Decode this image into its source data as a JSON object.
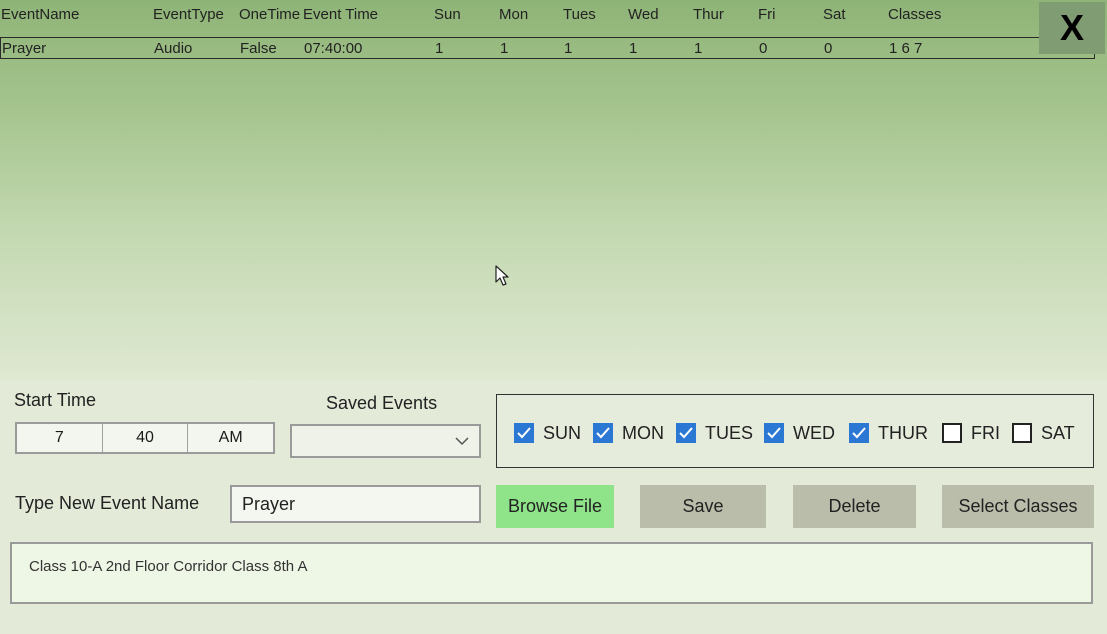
{
  "table": {
    "columns": [
      "EventName",
      "EventType",
      "OneTime",
      "Event Time",
      "Sun",
      "Mon",
      "Tues",
      "Wed",
      "Thur",
      "Fri",
      "Sat",
      "Classes"
    ],
    "rows": [
      [
        "Prayer",
        "Audio",
        "False",
        "07:40:00",
        "1",
        "1",
        "1",
        "1",
        "1",
        "0",
        "0",
        "1 6 7"
      ]
    ]
  },
  "close_button": {
    "label": "X"
  },
  "start_time": {
    "label": "Start Time",
    "hour": "7",
    "minute": "40",
    "period": "AM"
  },
  "saved_events": {
    "label": "Saved Events",
    "value": ""
  },
  "days": [
    {
      "label": "SUN",
      "checked": true
    },
    {
      "label": "MON",
      "checked": true
    },
    {
      "label": "TUES",
      "checked": true
    },
    {
      "label": "WED",
      "checked": true
    },
    {
      "label": "THUR",
      "checked": true
    },
    {
      "label": "FRI",
      "checked": false
    },
    {
      "label": "SAT",
      "checked": false
    }
  ],
  "event_name": {
    "label": "Type New Event Name",
    "value": "Prayer"
  },
  "buttons": {
    "browse": "Browse File",
    "save": "Save",
    "delete": "Delete",
    "select_classes": "Select Classes"
  },
  "classes_text": "Class 10-A 2nd Floor Corridor Class 8th A",
  "colors": {
    "checkbox_on": "#2a78d4",
    "browse_button": "#8fe48a",
    "gray_button": "#b9bdaa",
    "close_button": "#7f9c72"
  },
  "icons": {
    "close": "close-icon",
    "dropdown": "chevron-down-icon",
    "check": "check-icon",
    "cursor": "mouse-pointer-icon"
  }
}
